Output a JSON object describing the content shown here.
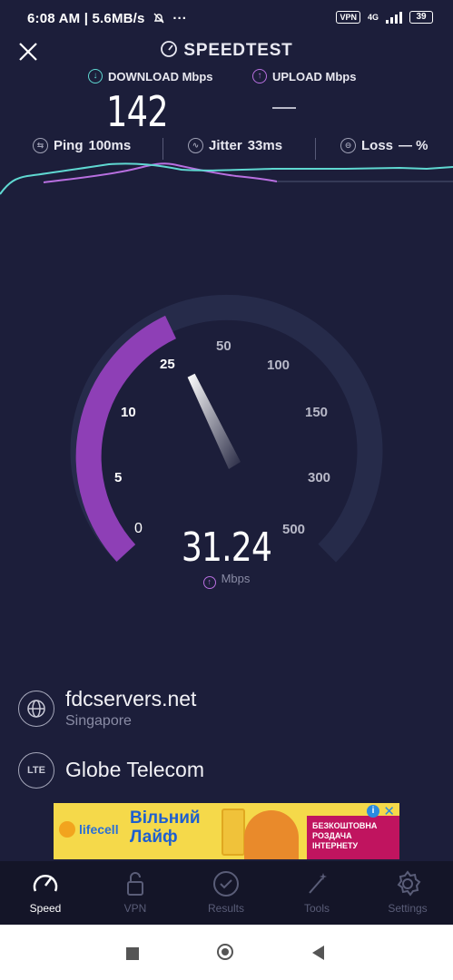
{
  "status_bar": {
    "time_speed": "6:08 AM | 5.6MB/s",
    "dots": "···",
    "vpn": "VPN",
    "network": "4G",
    "battery": "39"
  },
  "header": {
    "title": "SPEEDTEST"
  },
  "results": {
    "download_label": "DOWNLOAD Mbps",
    "upload_label": "UPLOAD Mbps",
    "download_value": "142",
    "upload_value": "—"
  },
  "stats": {
    "ping_label": "Ping",
    "ping_value": "100ms",
    "jitter_label": "Jitter",
    "jitter_value": "33ms",
    "loss_label": "Loss",
    "loss_value": "— %"
  },
  "gauge": {
    "ticks": [
      "0",
      "5",
      "10",
      "25",
      "50",
      "100",
      "150",
      "300",
      "500"
    ],
    "current_value": "31.24",
    "current_number": 31.24,
    "unit": "Mbps",
    "colors": {
      "active": "#8e3fb6",
      "track": "#262b4a"
    }
  },
  "server": {
    "host": "fdcservers.net",
    "location": "Singapore",
    "isp_badge": "LTE",
    "isp": "Globe Telecom"
  },
  "ad": {
    "brand": "lifecell",
    "headline_1": "Вільний",
    "headline_2": "Лайф",
    "promo": "БЕЗКОШТОВНА РОЗДАЧА ІНТЕРНЕТУ",
    "info_icon": "i",
    "close_icon": "✕"
  },
  "nav": {
    "items": [
      {
        "label": "Speed",
        "icon": "speed-icon"
      },
      {
        "label": "VPN",
        "icon": "lock-icon"
      },
      {
        "label": "Results",
        "icon": "check-circle-icon"
      },
      {
        "label": "Tools",
        "icon": "wand-icon"
      },
      {
        "label": "Settings",
        "icon": "gear-icon"
      }
    ]
  },
  "colors": {
    "background": "#1c1e3a",
    "download": "#5fd8d1",
    "upload": "#b86fe0"
  }
}
